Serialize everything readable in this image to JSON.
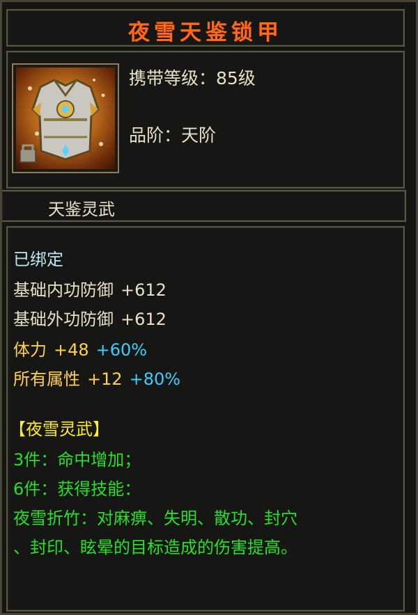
{
  "item": {
    "name": "夜雪天鉴锁甲",
    "level_label": "携带等级：85级",
    "grade_label": "品阶：天阶",
    "set_name_header": "天鉴灵武",
    "icon": "armor-icon"
  },
  "stats": {
    "bound": "已绑定",
    "base_internal_def": {
      "label": "基础内功防御",
      "value": "+612"
    },
    "base_external_def": {
      "label": "基础外功防御",
      "value": "+612"
    },
    "stamina": {
      "label": "体力",
      "value": "+48",
      "pct": "+60%"
    },
    "all_attr": {
      "label": "所有属性",
      "value": "+12",
      "pct": "+80%"
    }
  },
  "set_bonus": {
    "title": "【夜雪灵武】",
    "piece3": "3件：命中增加；",
    "piece6": "6件：获得技能：",
    "skill_line1": "夜雪折竹：对麻痹、失明、散功、封穴",
    "skill_line2": "、封印、眩晕的目标造成的伤害提高。"
  },
  "colors": {
    "title": "#ff6a1a",
    "normal_text": "#e8e0c8",
    "bound_text": "#bfe8f2",
    "attr_yellow": "#ffd24a",
    "pct_cyan": "#3ad0ff",
    "set_green": "#27e027",
    "set_title_yellow": "#ffee22"
  }
}
